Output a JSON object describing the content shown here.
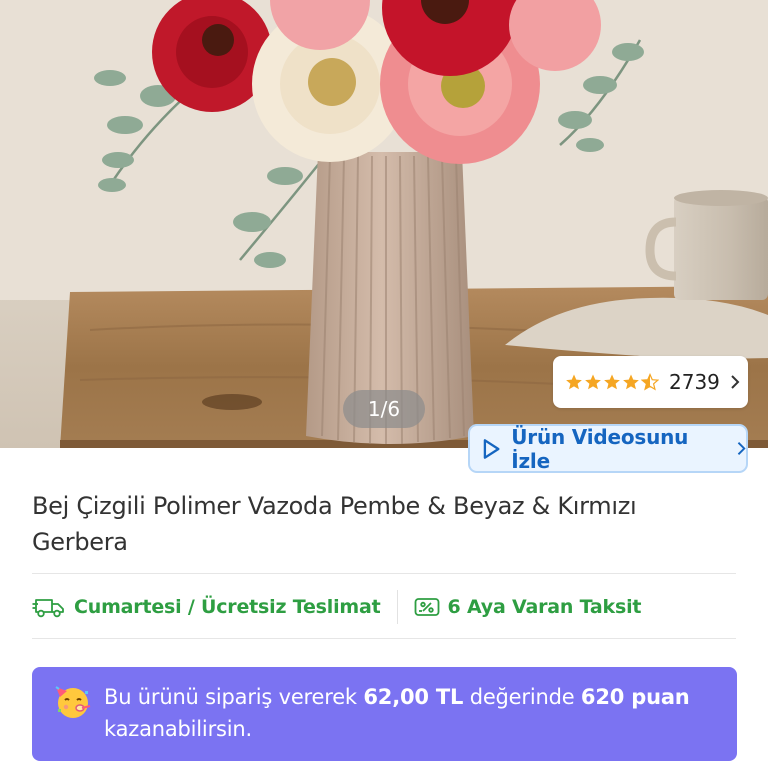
{
  "gallery": {
    "counter": "1/6",
    "rating": {
      "stars": 4.5,
      "count": "2739"
    },
    "video_button_label": "Ürün Videosunu İzle"
  },
  "product": {
    "title": "Bej Çizgili Polimer Vazoda Pembe & Beyaz & Kırmızı Gerbera"
  },
  "info": {
    "delivery": {
      "icon": "free-delivery-truck-icon",
      "label": "Cumartesi / Ücretsiz Teslimat"
    },
    "installment": {
      "icon": "installment-card-icon",
      "label": "6 Aya Varan Taksit"
    }
  },
  "points_banner": {
    "icon": "party-face-icon",
    "prefix": "Bu ürünü sipariş vererek ",
    "amount": "62,00 TL",
    "middle": " değerinde ",
    "points": "620 puan",
    "suffix": "kazanabilirsin."
  },
  "colors": {
    "accent_green": "#2e9e42",
    "banner_purple": "#7b73f2",
    "video_blue": "#1565c0",
    "star_orange": "#f5a623"
  }
}
